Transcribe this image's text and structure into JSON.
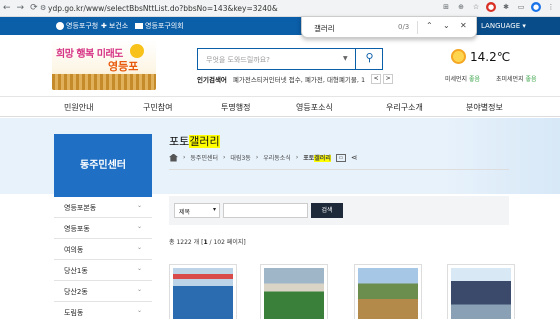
{
  "browser": {
    "url": "ydp.go.kr/www/selectBbsNttList.do?bbsNo=143&key=3240&",
    "nav_icons": [
      "back-icon",
      "forward-icon",
      "reload-icon"
    ]
  },
  "find_bar": {
    "query": "갤러리",
    "count": "0/3"
  },
  "topbar": {
    "items": [
      "영등포구청",
      "보건소",
      "영등포구의회"
    ],
    "language": "LANGUAGE"
  },
  "logo": {
    "text_top": "희망 행복 미래도",
    "text_bottom": "영등포"
  },
  "search": {
    "placeholder": "무엇을 도와드릴까요?",
    "popular_label": "인기검색어",
    "popular_keywords": "폐가전스티커인터넷 접수, 폐가전, 대형폐기물, 1",
    "prev": "<",
    "next": ">"
  },
  "weather": {
    "temp": "14.2℃",
    "fine_dust_label": "미세먼지",
    "fine_dust_value": "좋음",
    "ultrafine_label": "초미세먼지",
    "ultrafine_value": "좋음"
  },
  "main_nav": [
    "민원안내",
    "구민참여",
    "투명행정",
    "영등포소식",
    "우리구소개",
    "분야별정보"
  ],
  "sidebar": {
    "title": "동주민센터",
    "items": [
      "영등포본동",
      "영등포동",
      "여의동",
      "당산1동",
      "당산2동",
      "도림동"
    ]
  },
  "page": {
    "title_prefix": "포토",
    "title_highlight": "갤러리",
    "breadcrumb": [
      "동주민센터",
      "대림3동",
      "우리동소식"
    ],
    "breadcrumb_last_prefix": "포토",
    "breadcrumb_last_highlight": "갤러리"
  },
  "filter": {
    "select_value": "제목",
    "search_button": "검색"
  },
  "listing": {
    "total_prefix": "총",
    "total": "1222",
    "total_unit": "개",
    "page_current": "1",
    "page_total": "102 페이지"
  },
  "accent_color": "#0b5ea8"
}
